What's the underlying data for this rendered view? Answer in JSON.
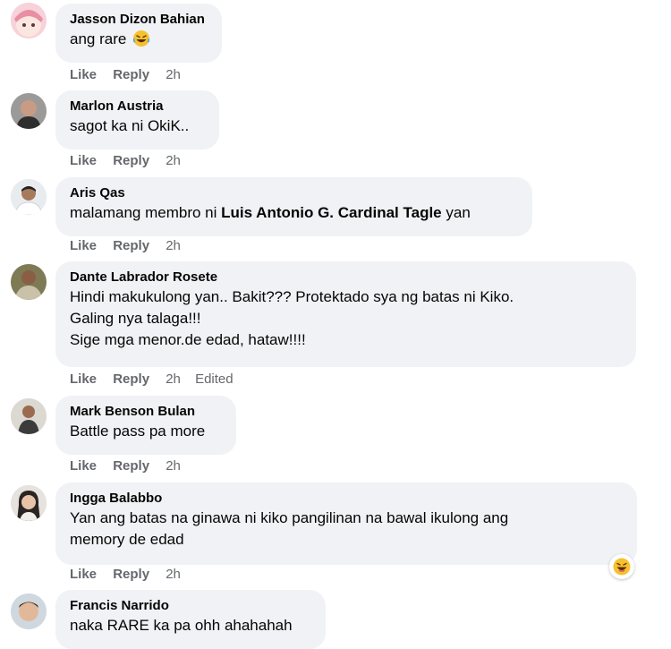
{
  "actions": {
    "like_label": "Like",
    "reply_label": "Reply"
  },
  "comments": [
    {
      "author": "Jasson Dizon Bahian",
      "line1": "ang rare",
      "emoji": "laughing-emoji",
      "time": "2h"
    },
    {
      "author": "Marlon Austria",
      "line1": "sagot ka ni OkiK..",
      "time": "2h"
    },
    {
      "author": "Aris Qas",
      "line1_prefix": "malamang membro ni ",
      "line1_mention": "Luis Antonio G. Cardinal Tagle",
      "line1_suffix": " yan",
      "time": "2h"
    },
    {
      "author": "Dante Labrador Rosete",
      "line1": "Hindi makukulong yan.. Bakit??? Protektado sya ng batas ni Kiko.",
      "line2": "Galing nya talaga!!!",
      "line3": "Sige mga menor.de edad, hataw!!!!",
      "time": "2h",
      "edited": "Edited"
    },
    {
      "author": "Mark Benson Bulan",
      "line1": "Battle pass pa more",
      "time": "2h"
    },
    {
      "author": "Ingga Balabbo",
      "line1": "Yan ang batas na ginawa ni kiko pangilinan na bawal ikulong ang",
      "line2": "memory de edad",
      "time": "2h",
      "reaction": "haha-reaction"
    },
    {
      "author": "Francis Narrido",
      "line1": "naka RARE ka pa ohh ahahahah"
    }
  ]
}
